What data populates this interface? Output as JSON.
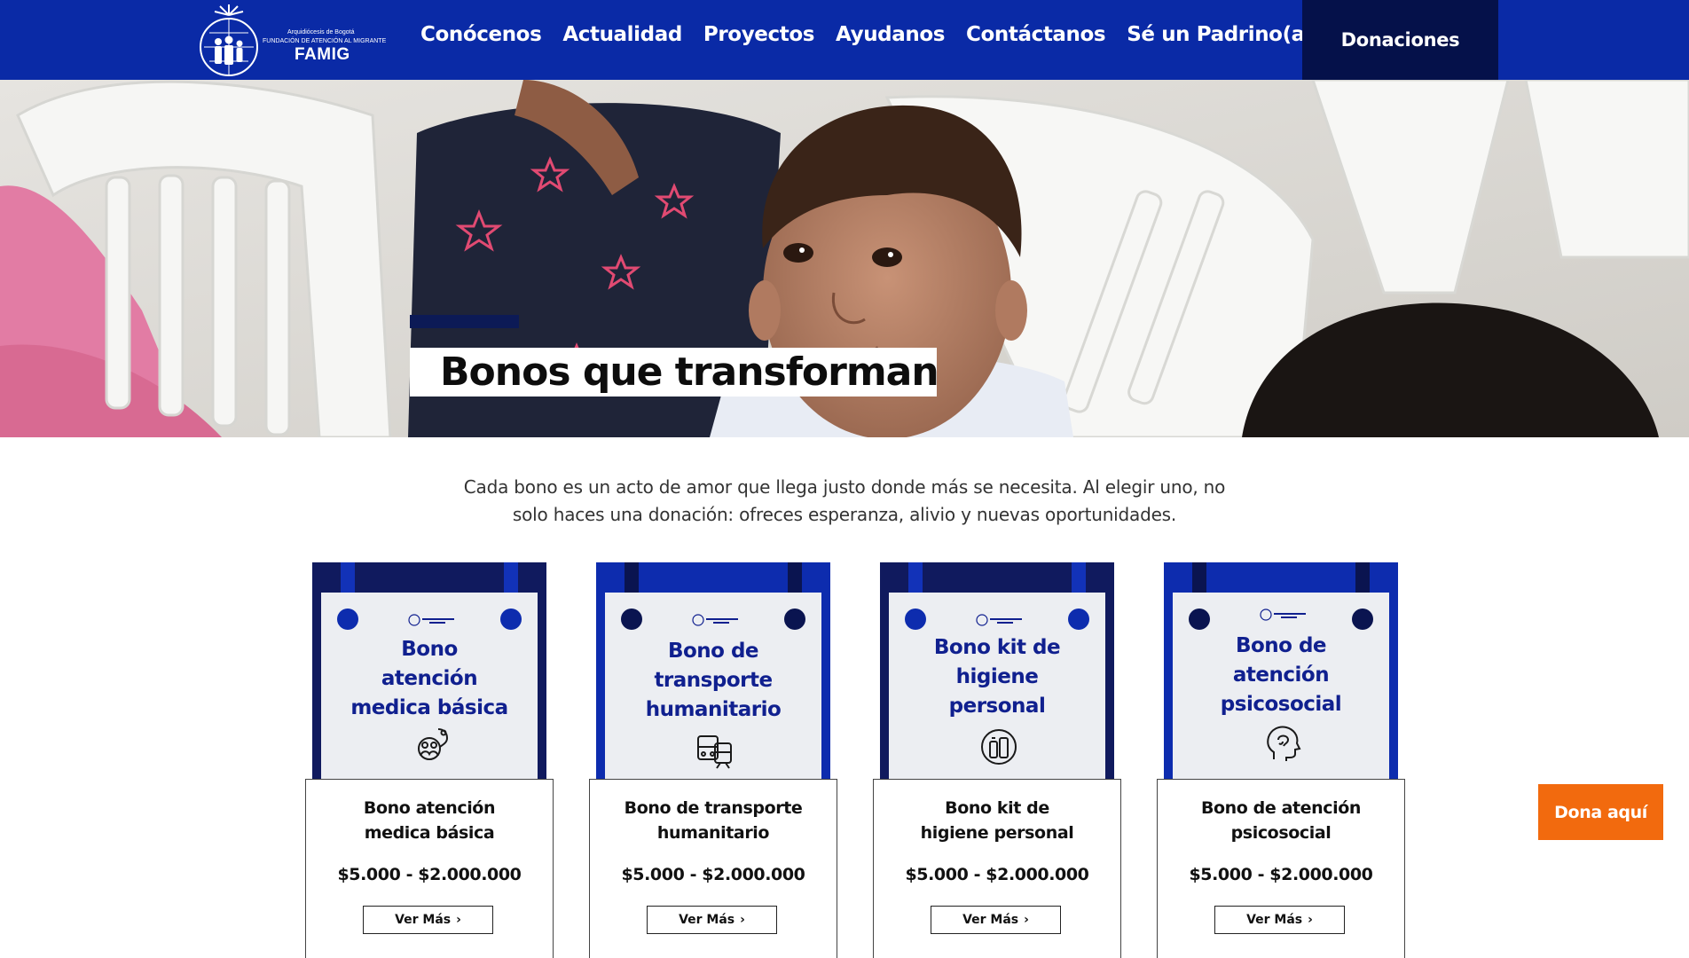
{
  "brand": {
    "logo_small_1": "Arquidiócesis de Bogotá",
    "logo_small_2": "FUNDACIÓN DE ATENCIÓN AL MIGRANTE",
    "logo_name": "FAMIG"
  },
  "nav": {
    "items": [
      {
        "label": "Conócenos"
      },
      {
        "label": "Actualidad"
      },
      {
        "label": "Proyectos"
      },
      {
        "label": "Ayudanos"
      },
      {
        "label": "Contáctanos"
      },
      {
        "label": "Sé un Padrino(a)"
      }
    ],
    "donate_label": "Donaciones"
  },
  "hero": {
    "title": "Bonos que transforman"
  },
  "intro": {
    "line1": "Cada bono es un acto de amor que llega justo donde más se necesita. Al elegir uno, no",
    "line2": "solo haces una donación: ofreces esperanza, alivio y nuevas oportunidades."
  },
  "cards": [
    {
      "image_title": [
        "Bono",
        "atención",
        "medica básica"
      ],
      "icon": "medical-icon",
      "title_lines": [
        "Bono atención",
        "medica básica"
      ],
      "price": "$5.000 - $2.000.000",
      "button": "Ver Más"
    },
    {
      "image_title": [
        "Bono de",
        "transporte",
        "humanitario"
      ],
      "icon": "transport-icon",
      "title_lines": [
        "Bono de transporte",
        "humanitario"
      ],
      "price": "$5.000 - $2.000.000",
      "button": "Ver Más"
    },
    {
      "image_title": [
        "Bono kit de",
        "higiene",
        "personal"
      ],
      "icon": "hygiene-icon",
      "title_lines": [
        "Bono kit de",
        "higiene personal"
      ],
      "price": "$5.000 - $2.000.000",
      "button": "Ver Más"
    },
    {
      "image_title": [
        "Bono de",
        "atención",
        "psicosocial"
      ],
      "icon": "psychology-icon",
      "title_lines": [
        "Bono de atención",
        "psicosocial"
      ],
      "price": "$5.000 - $2.000.000",
      "button": "Ver Más"
    }
  ],
  "float_button": "Dona aquí",
  "colors": {
    "header": "#0a2aa6",
    "donate_bg": "#05114a",
    "accent_orange": "#f26a0e",
    "card_title_blue": "#10208f"
  }
}
